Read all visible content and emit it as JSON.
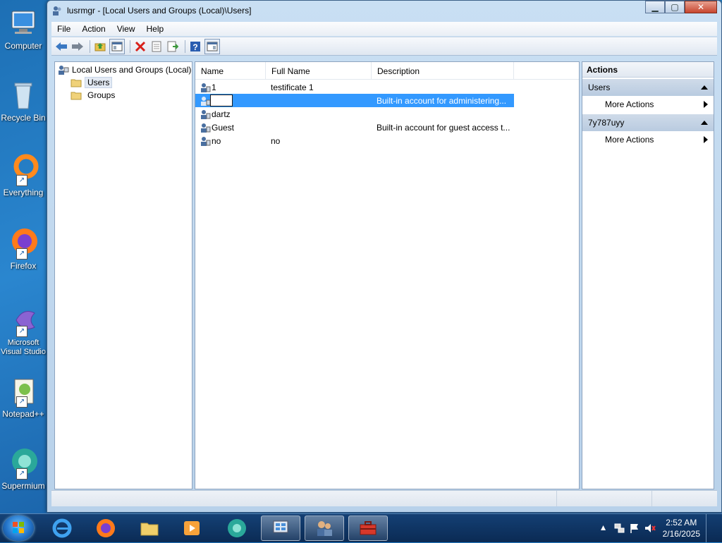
{
  "desktop": {
    "icons": [
      {
        "label": "Computer"
      },
      {
        "label": "Recycle Bin"
      },
      {
        "label": "Everything"
      },
      {
        "label": "Firefox"
      },
      {
        "label": "Microsoft Visual Studio"
      },
      {
        "label": "Notepad++"
      },
      {
        "label": "Supermium"
      }
    ]
  },
  "window": {
    "title": "lusrmgr - [Local Users and Groups (Local)\\Users]",
    "buttons": {
      "minimize": "▁",
      "maximize": "▢",
      "close": "✕"
    }
  },
  "menu": {
    "items": [
      {
        "label": "File"
      },
      {
        "label": "Action"
      },
      {
        "label": "View"
      },
      {
        "label": "Help"
      }
    ]
  },
  "toolbar": {
    "buttons": [
      {
        "name": "back-icon"
      },
      {
        "name": "forward-icon"
      },
      {
        "name": "up-folder-icon"
      },
      {
        "name": "show-hide-tree-icon"
      },
      {
        "name": "delete-icon"
      },
      {
        "name": "properties-icon"
      },
      {
        "name": "export-list-icon"
      },
      {
        "name": "help-icon"
      },
      {
        "name": "show-hide-action-pane-icon"
      }
    ]
  },
  "tree": {
    "root": "Local Users and Groups (Local)",
    "children": [
      {
        "label": "Users",
        "selected": true
      },
      {
        "label": "Groups",
        "selected": false
      }
    ]
  },
  "list": {
    "columns": [
      "Name",
      "Full Name",
      "Description"
    ],
    "rows": [
      {
        "name": "1",
        "full_name": "testificate 1",
        "description": ""
      },
      {
        "name": "",
        "full_name": "",
        "description": "Built-in account for administering...",
        "selected": true,
        "renaming": true
      },
      {
        "name": "dartz",
        "full_name": "",
        "description": ""
      },
      {
        "name": "Guest",
        "full_name": "",
        "description": "Built-in account for guest access t..."
      },
      {
        "name": "no",
        "full_name": "no",
        "description": ""
      }
    ]
  },
  "actions": {
    "header": "Actions",
    "sections": [
      {
        "title": "Users",
        "items": [
          "More Actions"
        ]
      },
      {
        "title": "7y787uyy",
        "items": [
          "More Actions"
        ]
      }
    ]
  },
  "taskbar": {
    "pinned": [
      {
        "name": "internet-explorer-icon"
      },
      {
        "name": "firefox-icon"
      },
      {
        "name": "file-explorer-icon"
      },
      {
        "name": "media-player-icon"
      },
      {
        "name": "supermium-icon"
      },
      {
        "name": "control-panel-icon"
      },
      {
        "name": "users-icon"
      },
      {
        "name": "toolbox-icon"
      }
    ],
    "clock": {
      "time": "2:52 AM",
      "date": "2/16/2025"
    }
  },
  "colors": {
    "selection": "#3399ff",
    "accent": "#1d6fb4"
  }
}
